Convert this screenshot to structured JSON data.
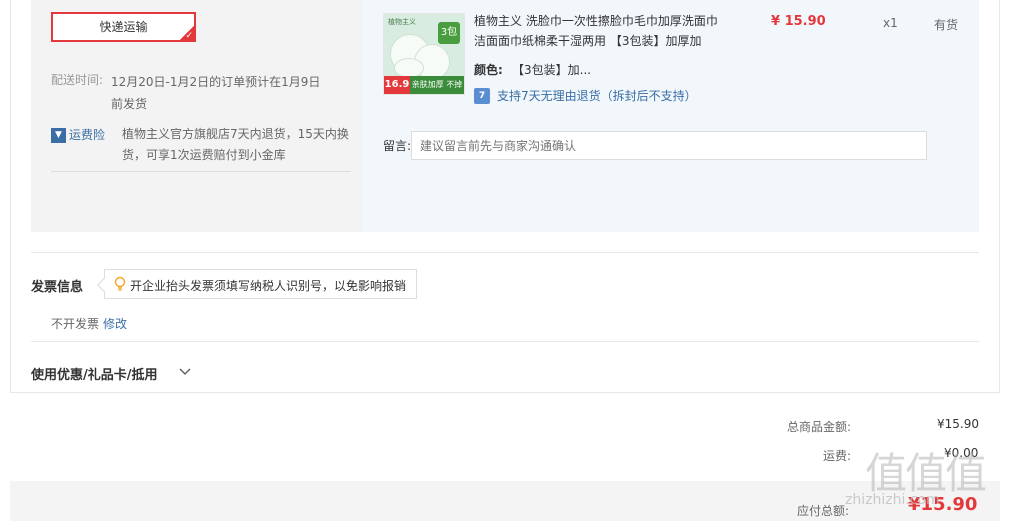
{
  "shipping": {
    "method_label": "快递运输",
    "delivery_label": "配送时间:",
    "delivery_value": "12月20日-1月2日的订单预计在1月9日前发货",
    "insurance_label": "运费险",
    "insurance_desc": "植物主义官方旗舰店7天内退货，15天内换货，可享1次运费赔付到小金库"
  },
  "product": {
    "title": "植物主义 洗脸巾一次性擦脸巾毛巾加厚洗面巾洁面面巾纸棉柔干湿两用 【3包装】加厚加",
    "color_label": "颜色:",
    "color_value": "【3包装】加...",
    "return_policy": "支持7天无理由退货（拆封后不支持）",
    "price": "¥ 15.90",
    "qty": "x1",
    "stock": "有货",
    "thumb": {
      "brand": "植物主义",
      "badge": "3包",
      "price_tag": "16.9",
      "strip": "亲肤加厚 不掉絮"
    }
  },
  "note": {
    "label": "留言:",
    "placeholder": "建议留言前先与商家沟通确认"
  },
  "invoice": {
    "title": "发票信息",
    "tip": "开企业抬头发票须填写纳税人识别号，以免影响报销",
    "value": "不开发票",
    "edit": "修改"
  },
  "coupon": {
    "title": "使用优惠/礼品卡/抵用"
  },
  "summary": {
    "goods_label": "总商品金额:",
    "goods_value": "¥15.90",
    "freight_label": "运费:",
    "freight_value": "¥0.00",
    "total_label": "应付总额:",
    "total_value": "¥15.90"
  },
  "watermark": {
    "glyphs": "值值值",
    "url": "zhizhizhi.com"
  },
  "colors": {
    "accent": "#e4393c",
    "link": "#3a6ea5",
    "order_bg": "#f1f7fb"
  }
}
